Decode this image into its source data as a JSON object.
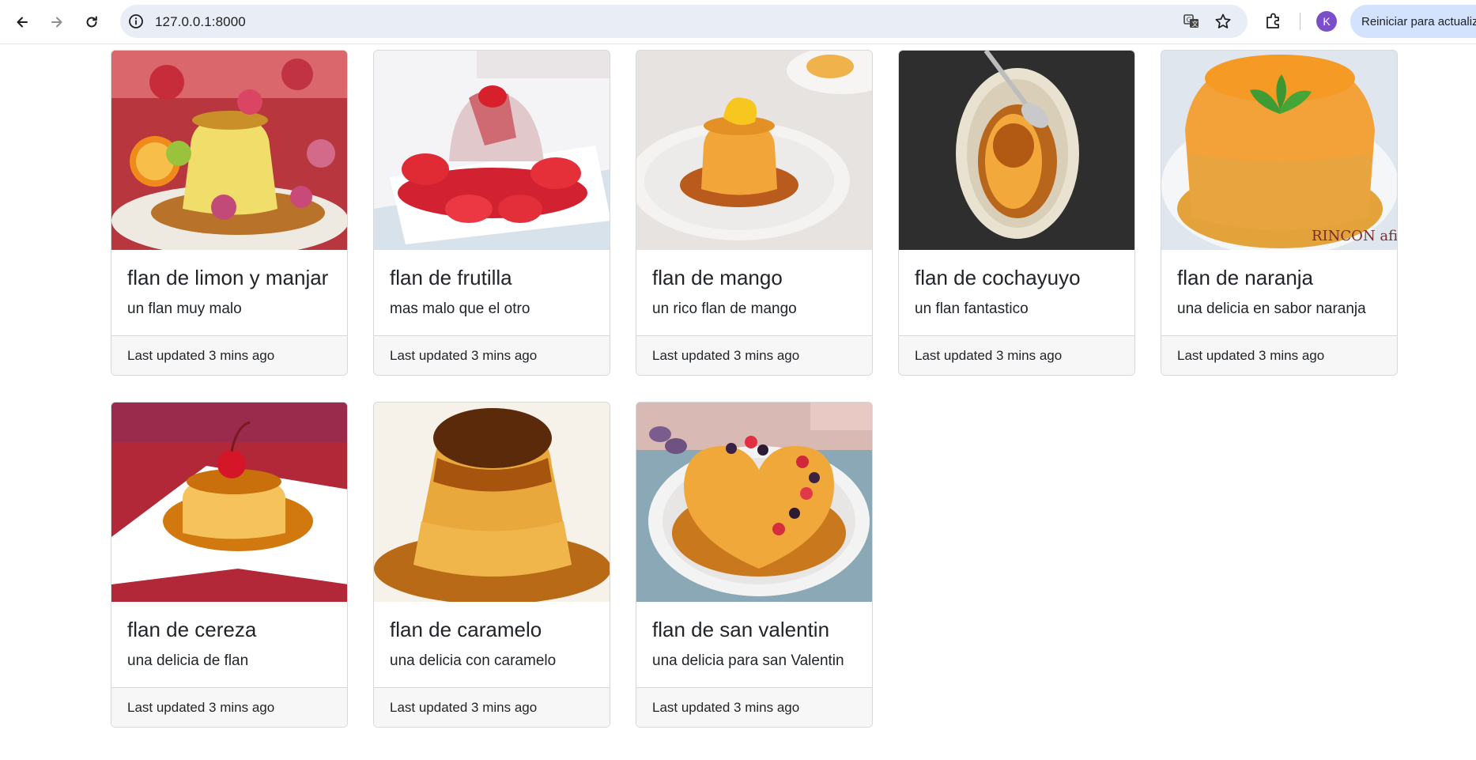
{
  "browser": {
    "url": "127.0.0.1:8000",
    "avatar_letter": "K",
    "update_button": "Reiniciar para actualizar"
  },
  "cards": [
    {
      "title": "flan de limon y manjar",
      "text": "un flan muy malo",
      "footer": "Last updated 3 mins ago"
    },
    {
      "title": "flan de frutilla",
      "text": "mas malo que el otro",
      "footer": "Last updated 3 mins ago"
    },
    {
      "title": "flan de mango",
      "text": "un rico flan de mango",
      "footer": "Last updated 3 mins ago"
    },
    {
      "title": "flan de cochayuyo",
      "text": "un flan fantastico",
      "footer": "Last updated 3 mins ago"
    },
    {
      "title": "flan de naranja",
      "text": "una delicia en sabor naranja",
      "footer": "Last updated 3 mins ago"
    },
    {
      "title": "flan de cereza",
      "text": "una delicia de flan",
      "footer": "Last updated 3 mins ago"
    },
    {
      "title": "flan de caramelo",
      "text": "una delicia con caramelo",
      "footer": "Last updated 3 mins ago"
    },
    {
      "title": "flan de san valentin",
      "text": "una delicia para san Valentin",
      "footer": "Last updated 3 mins ago"
    }
  ]
}
